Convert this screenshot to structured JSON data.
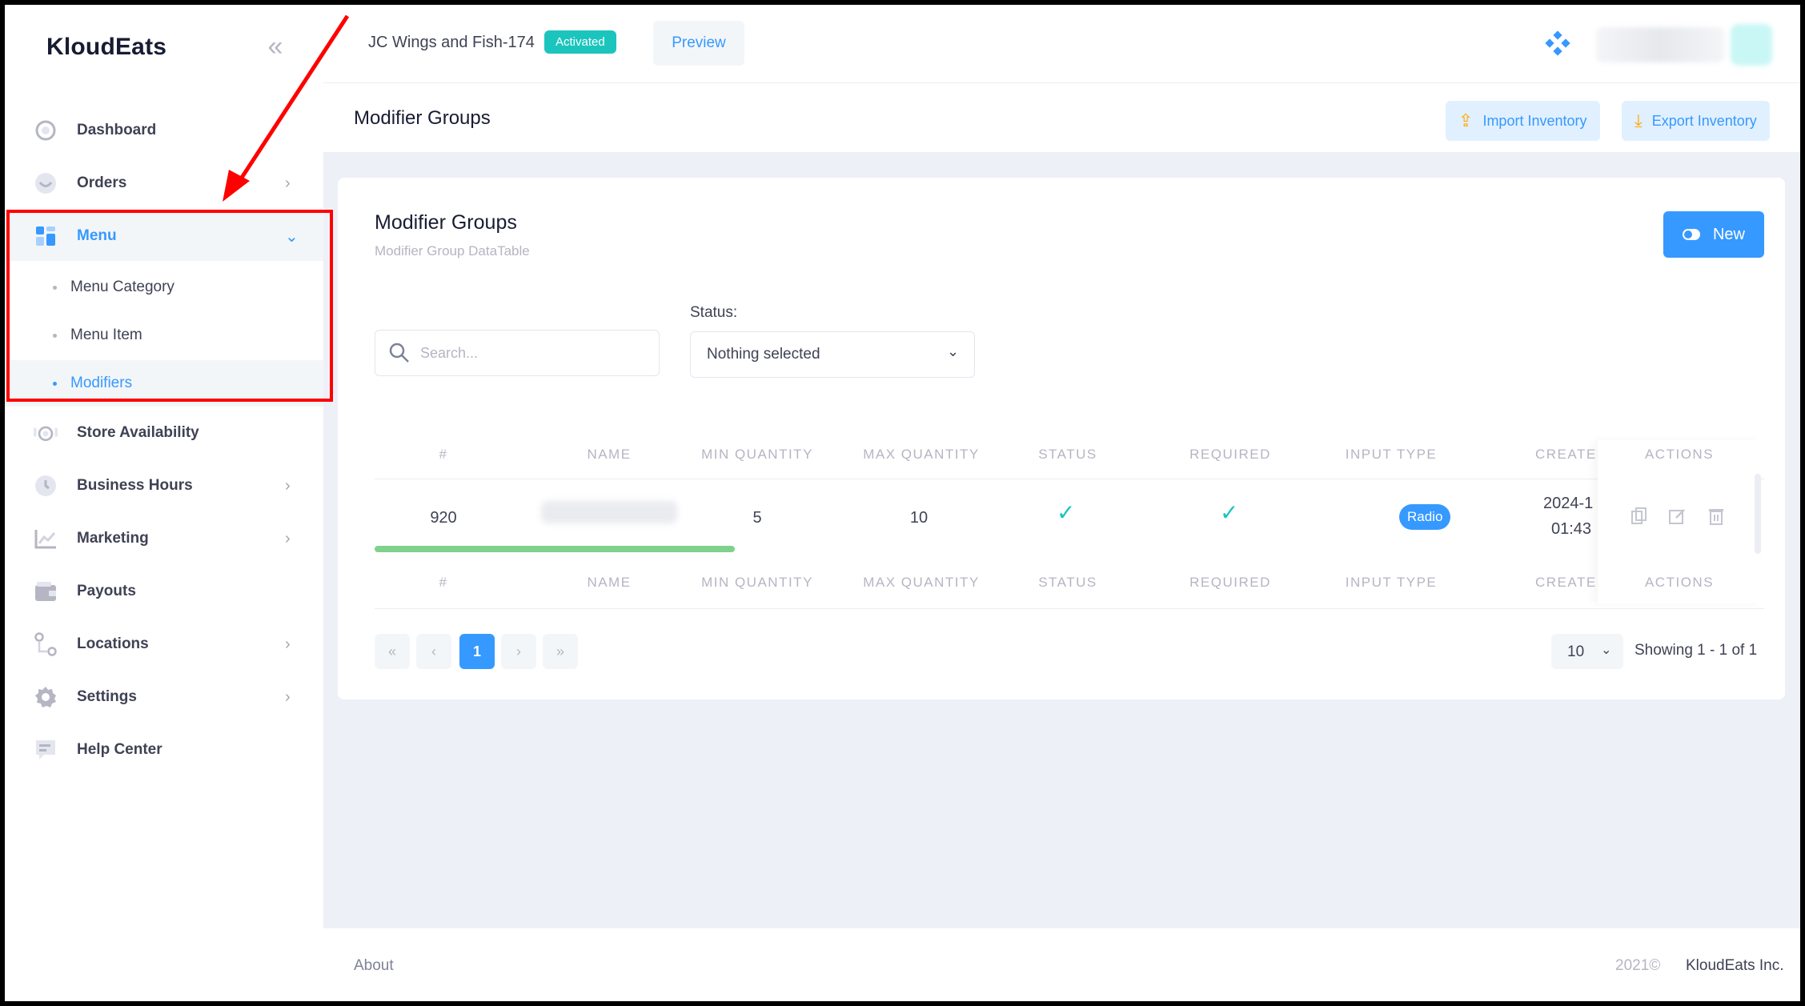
{
  "brand": "KloudEats",
  "header": {
    "store_name": "JC Wings and Fish-174",
    "status_badge": "Activated",
    "preview_label": "Preview"
  },
  "sidebar": {
    "items": [
      {
        "label": "Dashboard",
        "icon": "dashboard-icon"
      },
      {
        "label": "Orders",
        "icon": "orders-icon"
      },
      {
        "label": "Menu",
        "icon": "menu-icon"
      },
      {
        "label": "Store Availability",
        "icon": "store-icon"
      },
      {
        "label": "Business Hours",
        "icon": "clock-icon"
      },
      {
        "label": "Marketing",
        "icon": "chart-icon"
      },
      {
        "label": "Payouts",
        "icon": "wallet-icon"
      },
      {
        "label": "Locations",
        "icon": "location-icon"
      },
      {
        "label": "Settings",
        "icon": "gear-icon"
      },
      {
        "label": "Help Center",
        "icon": "chat-icon"
      }
    ],
    "menu_sub": [
      {
        "label": "Menu Category"
      },
      {
        "label": "Menu Item"
      },
      {
        "label": "Modifiers"
      }
    ]
  },
  "subheader": {
    "title": "Modifier Groups",
    "import_label": "Import Inventory",
    "export_label": "Export Inventory"
  },
  "card": {
    "title": "Modifier Groups",
    "subtitle": "Modifier Group DataTable",
    "new_label": "New",
    "search_placeholder": "Search...",
    "status_label": "Status:",
    "status_value": "Nothing selected"
  },
  "table": {
    "columns": [
      "#",
      "NAME",
      "MIN QUANTITY",
      "MAX QUANTITY",
      "STATUS",
      "REQUIRED",
      "INPUT TYPE",
      "CREATE",
      "ACTIONS"
    ],
    "rows": [
      {
        "id": "920",
        "min": "5",
        "max": "10",
        "input_type": "Radio",
        "created_date": "2024-1",
        "created_time": "01:43"
      }
    ]
  },
  "pagination": {
    "first": "«",
    "prev": "‹",
    "current": "1",
    "next": "›",
    "last": "»",
    "per_page": "10",
    "showing": "Showing 1 - 1 of 1"
  },
  "footer": {
    "about": "About",
    "year": "2021©",
    "company": "KloudEats Inc."
  },
  "colors": {
    "primary": "#3699ff",
    "success": "#1bc5bd",
    "annotation": "#ff0000"
  }
}
